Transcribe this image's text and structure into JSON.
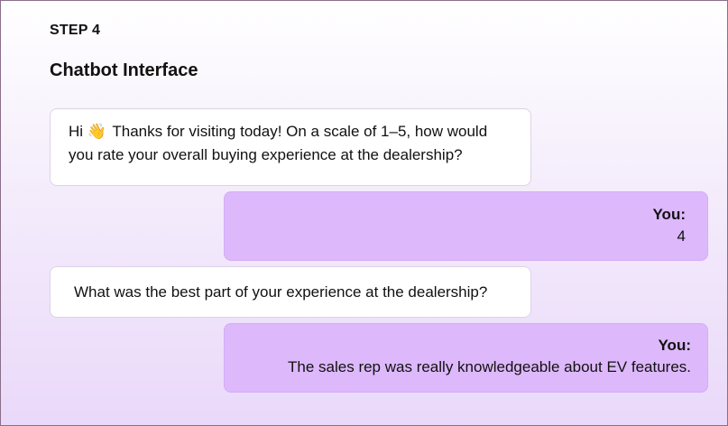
{
  "step": {
    "label": "STEP 4"
  },
  "title": "Chatbot Interface",
  "messages": [
    {
      "role": "bot",
      "greeting": "Hi",
      "icon": "waving-hand-icon",
      "icon_glyph": "👋",
      "text": "Thanks for visiting today! On a scale of 1–5, how would you rate your overall buying experience at the dealership?"
    },
    {
      "role": "user",
      "speaker": "You:",
      "text": "4"
    },
    {
      "role": "bot",
      "text": "What was the best part of your experience at the dealership?"
    },
    {
      "role": "user",
      "speaker": "You:",
      "text": "The sales rep was really knowledgeable about EV features."
    }
  ],
  "colors": {
    "user_bubble": "#ddb8fb",
    "bot_bubble": "#ffffff",
    "background_bottom": "#ead9fa"
  }
}
